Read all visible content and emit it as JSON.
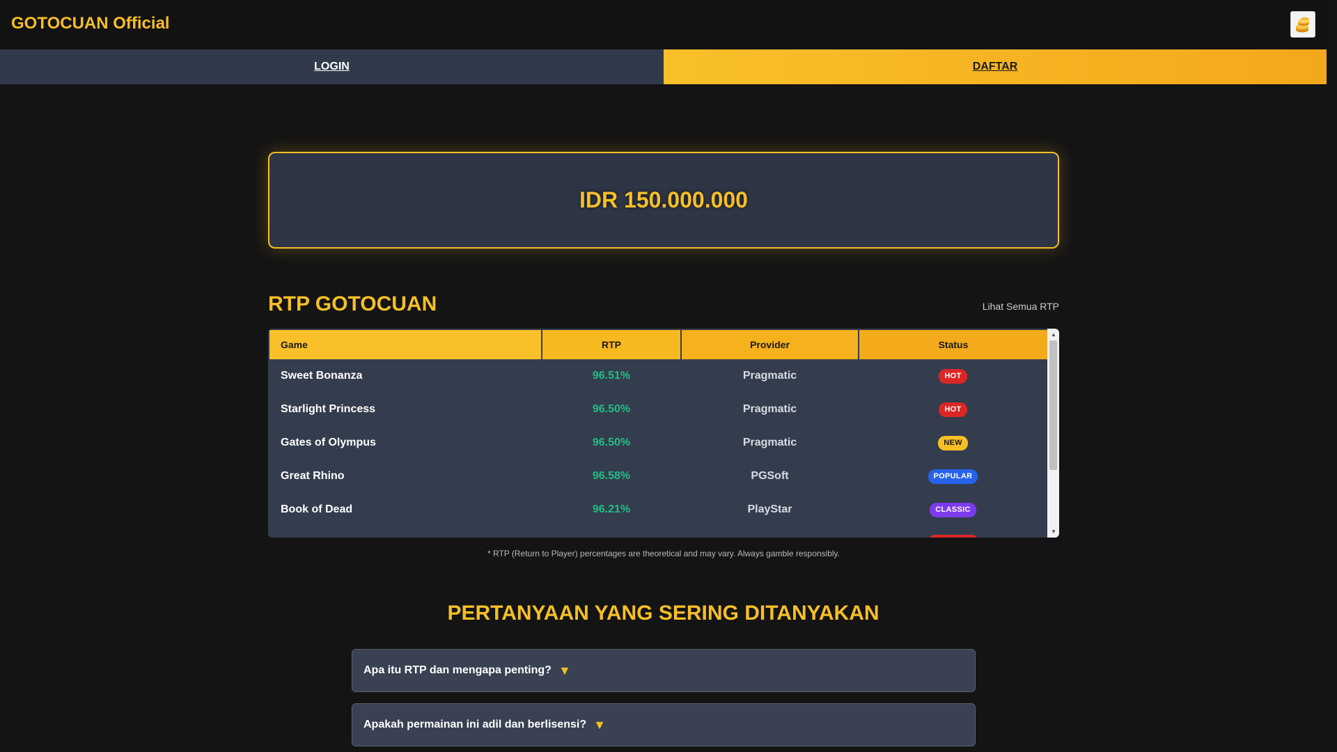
{
  "header": {
    "brand": "GOTOCUAN Official",
    "coin_icon": "coin-stack-icon"
  },
  "auth": {
    "login_label": "LOGIN",
    "daftar_label": "DAFTAR"
  },
  "jackpot": {
    "amount": "IDR 150.000.000"
  },
  "rtp": {
    "title": "RTP GOTOCUAN",
    "view_all": "Lihat Semua RTP",
    "columns": [
      "Game",
      "RTP",
      "Provider",
      "Status"
    ],
    "rows": [
      {
        "game": "Sweet Bonanza",
        "rtp": "96.51%",
        "provider": "Pragmatic",
        "status": "HOT"
      },
      {
        "game": "Starlight Princess",
        "rtp": "96.50%",
        "provider": "Pragmatic",
        "status": "HOT"
      },
      {
        "game": "Gates of Olympus",
        "rtp": "96.50%",
        "provider": "Pragmatic",
        "status": "NEW"
      },
      {
        "game": "Great Rhino",
        "rtp": "96.58%",
        "provider": "PGSoft",
        "status": "POPULAR"
      },
      {
        "game": "Book of Dead",
        "rtp": "96.21%",
        "provider": "PlayStar",
        "status": "CLASSIC"
      }
    ],
    "note": "* RTP (Return to Player) percentages are theoretical and may vary. Always gamble responsibly."
  },
  "faq": {
    "title": "PERTANYAAN YANG SERING DITANYAKAN",
    "items": [
      {
        "question": "Apa itu RTP dan mengapa penting?"
      },
      {
        "question": "Apakah permainan ini adil dan berlisensi?"
      }
    ]
  },
  "colors": {
    "accent": "#f6bf26",
    "rtp_green": "#1fbf83",
    "badge_hot": "#dc2626",
    "badge_new": "#f6bf26",
    "badge_popular": "#2563eb",
    "badge_classic": "#7c3aed"
  }
}
